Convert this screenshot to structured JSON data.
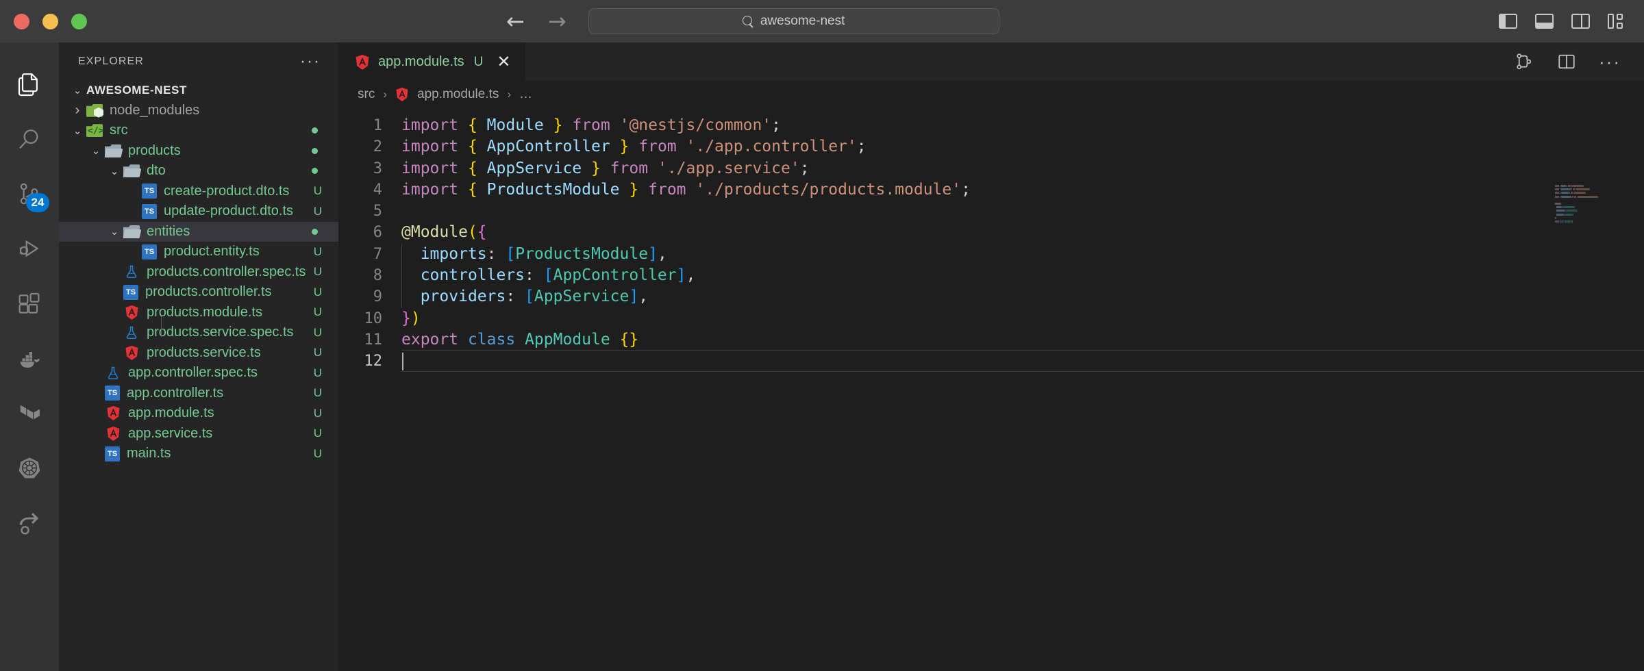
{
  "titlebar": {
    "traffic_lights": [
      "close",
      "minimize",
      "maximize"
    ],
    "back_arrow": "←",
    "forward_arrow": "→",
    "command_center_text": "awesome-nest",
    "command_center_icon": "search-icon",
    "layout_actions": [
      {
        "name": "toggle-primary-sidebar",
        "label": "Toggle Primary Side Bar"
      },
      {
        "name": "toggle-panel",
        "label": "Toggle Panel"
      },
      {
        "name": "toggle-secondary-sidebar",
        "label": "Toggle Secondary Side Bar"
      },
      {
        "name": "customize-layout",
        "label": "Customize Layout"
      }
    ]
  },
  "activitybar": {
    "items": [
      {
        "name": "explorer",
        "icon": "files-icon",
        "active": true,
        "badge": ""
      },
      {
        "name": "search",
        "icon": "search-icon",
        "active": false,
        "badge": ""
      },
      {
        "name": "source-control",
        "icon": "source-control-icon",
        "active": false,
        "badge": "24"
      },
      {
        "name": "run-and-debug",
        "icon": "debug-icon",
        "active": false,
        "badge": ""
      },
      {
        "name": "extensions",
        "icon": "extensions-icon",
        "active": false,
        "badge": ""
      },
      {
        "name": "docker",
        "icon": "docker-icon",
        "active": false,
        "badge": ""
      },
      {
        "name": "terraform",
        "icon": "terraform-icon",
        "active": false,
        "badge": ""
      },
      {
        "name": "kubernetes",
        "icon": "kubernetes-icon",
        "active": false,
        "badge": ""
      },
      {
        "name": "chameleon",
        "icon": "chameleon-icon",
        "active": false,
        "badge": ""
      }
    ]
  },
  "sidebar": {
    "title": "EXPLORER",
    "more_actions": "···",
    "root": {
      "label": "AWESOME-NEST",
      "expanded": true
    },
    "tree": [
      {
        "label": "node_modules",
        "indent": 1,
        "type": "folder",
        "icon": "folder-node-icon",
        "twisty": "collapsed",
        "color": "dim",
        "status": ""
      },
      {
        "label": "src",
        "indent": 1,
        "type": "folder",
        "icon": "folder-src-icon",
        "twisty": "expanded",
        "color": "green",
        "status": "dot"
      },
      {
        "label": "products",
        "indent": 2,
        "type": "folder",
        "icon": "folder-icon",
        "twisty": "expanded",
        "color": "green",
        "status": "dot"
      },
      {
        "label": "dto",
        "indent": 3,
        "type": "folder",
        "icon": "folder-icon",
        "twisty": "expanded",
        "color": "green",
        "status": "dot"
      },
      {
        "label": "create-product.dto.ts",
        "indent": 4,
        "type": "file",
        "icon": "typescript-icon",
        "twisty": "none",
        "color": "green",
        "status": "U"
      },
      {
        "label": "update-product.dto.ts",
        "indent": 4,
        "type": "file",
        "icon": "typescript-icon",
        "twisty": "none",
        "color": "green",
        "status": "U"
      },
      {
        "label": "entities",
        "indent": 3,
        "type": "folder",
        "icon": "folder-icon",
        "twisty": "expanded",
        "color": "green",
        "status": "dot",
        "selected": true
      },
      {
        "label": "product.entity.ts",
        "indent": 4,
        "type": "file",
        "icon": "typescript-icon",
        "twisty": "none",
        "color": "green",
        "status": "U"
      },
      {
        "label": "products.controller.spec.ts",
        "indent": 3,
        "type": "file",
        "icon": "test-flask-icon",
        "twisty": "none",
        "color": "green",
        "status": "U"
      },
      {
        "label": "products.controller.ts",
        "indent": 3,
        "type": "file",
        "icon": "typescript-icon",
        "twisty": "none",
        "color": "green",
        "status": "U"
      },
      {
        "label": "products.module.ts",
        "indent": 3,
        "type": "file",
        "icon": "nest-shield-icon",
        "twisty": "none",
        "color": "green",
        "status": "U"
      },
      {
        "label": "products.service.spec.ts",
        "indent": 3,
        "type": "file",
        "icon": "test-flask-icon",
        "twisty": "none",
        "color": "green",
        "status": "U"
      },
      {
        "label": "products.service.ts",
        "indent": 3,
        "type": "file",
        "icon": "nest-shield-icon",
        "twisty": "none",
        "color": "green",
        "status": "U"
      },
      {
        "label": "app.controller.spec.ts",
        "indent": 2,
        "type": "file",
        "icon": "test-flask-icon",
        "twisty": "none",
        "color": "green",
        "status": "U"
      },
      {
        "label": "app.controller.ts",
        "indent": 2,
        "type": "file",
        "icon": "typescript-icon",
        "twisty": "none",
        "color": "green",
        "status": "U"
      },
      {
        "label": "app.module.ts",
        "indent": 2,
        "type": "file",
        "icon": "nest-shield-icon",
        "twisty": "none",
        "color": "green",
        "status": "U"
      },
      {
        "label": "app.service.ts",
        "indent": 2,
        "type": "file",
        "icon": "nest-shield-icon",
        "twisty": "none",
        "color": "green",
        "status": "U"
      },
      {
        "label": "main.ts",
        "indent": 2,
        "type": "file",
        "icon": "typescript-icon",
        "twisty": "none",
        "color": "green",
        "status": "U"
      }
    ]
  },
  "editor": {
    "tab": {
      "filename": "app.module.ts",
      "icon": "nest-shield-icon",
      "dirty_badge": "U",
      "close": "✕"
    },
    "tab_actions": [
      {
        "name": "source-control-graph",
        "label": "Open Changes"
      },
      {
        "name": "split-editor",
        "label": "Split Editor Right"
      },
      {
        "name": "more-actions",
        "label": "More Actions..."
      }
    ],
    "breadcrumb": [
      "src",
      "app.module.ts",
      "…"
    ],
    "breadcrumb_file_icon": "nest-shield-icon",
    "line_numbers": [
      "1",
      "2",
      "3",
      "4",
      "5",
      "6",
      "7",
      "8",
      "9",
      "10",
      "11",
      "12"
    ],
    "current_line": 12,
    "code_lines": [
      [
        {
          "t": "import",
          "c": "kw"
        },
        {
          "t": " ",
          "c": "pl"
        },
        {
          "t": "{",
          "c": "br"
        },
        {
          "t": " ",
          "c": "pl"
        },
        {
          "t": "Module",
          "c": "id"
        },
        {
          "t": " ",
          "c": "pl"
        },
        {
          "t": "}",
          "c": "br"
        },
        {
          "t": " ",
          "c": "pl"
        },
        {
          "t": "from",
          "c": "kw"
        },
        {
          "t": " ",
          "c": "pl"
        },
        {
          "t": "'@nestjs/common'",
          "c": "str"
        },
        {
          "t": ";",
          "c": "pl"
        }
      ],
      [
        {
          "t": "import",
          "c": "kw"
        },
        {
          "t": " ",
          "c": "pl"
        },
        {
          "t": "{",
          "c": "br"
        },
        {
          "t": " ",
          "c": "pl"
        },
        {
          "t": "AppController",
          "c": "id"
        },
        {
          "t": " ",
          "c": "pl"
        },
        {
          "t": "}",
          "c": "br"
        },
        {
          "t": " ",
          "c": "pl"
        },
        {
          "t": "from",
          "c": "kw"
        },
        {
          "t": " ",
          "c": "pl"
        },
        {
          "t": "'./app.controller'",
          "c": "str"
        },
        {
          "t": ";",
          "c": "pl"
        }
      ],
      [
        {
          "t": "import",
          "c": "kw"
        },
        {
          "t": " ",
          "c": "pl"
        },
        {
          "t": "{",
          "c": "br"
        },
        {
          "t": " ",
          "c": "pl"
        },
        {
          "t": "AppService",
          "c": "id"
        },
        {
          "t": " ",
          "c": "pl"
        },
        {
          "t": "}",
          "c": "br"
        },
        {
          "t": " ",
          "c": "pl"
        },
        {
          "t": "from",
          "c": "kw"
        },
        {
          "t": " ",
          "c": "pl"
        },
        {
          "t": "'./app.service'",
          "c": "str"
        },
        {
          "t": ";",
          "c": "pl"
        }
      ],
      [
        {
          "t": "import",
          "c": "kw"
        },
        {
          "t": " ",
          "c": "pl"
        },
        {
          "t": "{",
          "c": "br"
        },
        {
          "t": " ",
          "c": "pl"
        },
        {
          "t": "ProductsModule",
          "c": "id"
        },
        {
          "t": " ",
          "c": "pl"
        },
        {
          "t": "}",
          "c": "br"
        },
        {
          "t": " ",
          "c": "pl"
        },
        {
          "t": "from",
          "c": "kw"
        },
        {
          "t": " ",
          "c": "pl"
        },
        {
          "t": "'./products/products.module'",
          "c": "str"
        },
        {
          "t": ";",
          "c": "pl"
        }
      ],
      [],
      [
        {
          "t": "@Module",
          "c": "dec"
        },
        {
          "t": "(",
          "c": "br"
        },
        {
          "t": "{",
          "c": "br2"
        }
      ],
      [
        {
          "t": "  ",
          "c": "pl"
        },
        {
          "t": "imports",
          "c": "id"
        },
        {
          "t": ": ",
          "c": "pl"
        },
        {
          "t": "[",
          "c": "br3"
        },
        {
          "t": "ProductsModule",
          "c": "cls"
        },
        {
          "t": "]",
          "c": "br3"
        },
        {
          "t": ",",
          "c": "pl"
        }
      ],
      [
        {
          "t": "  ",
          "c": "pl"
        },
        {
          "t": "controllers",
          "c": "id"
        },
        {
          "t": ": ",
          "c": "pl"
        },
        {
          "t": "[",
          "c": "br3"
        },
        {
          "t": "AppController",
          "c": "cls"
        },
        {
          "t": "]",
          "c": "br3"
        },
        {
          "t": ",",
          "c": "pl"
        }
      ],
      [
        {
          "t": "  ",
          "c": "pl"
        },
        {
          "t": "providers",
          "c": "id"
        },
        {
          "t": ": ",
          "c": "pl"
        },
        {
          "t": "[",
          "c": "br3"
        },
        {
          "t": "AppService",
          "c": "cls"
        },
        {
          "t": "]",
          "c": "br3"
        },
        {
          "t": ",",
          "c": "pl"
        }
      ],
      [
        {
          "t": "}",
          "c": "br2"
        },
        {
          "t": ")",
          "c": "br"
        }
      ],
      [
        {
          "t": "export",
          "c": "kw"
        },
        {
          "t": " ",
          "c": "pl"
        },
        {
          "t": "class",
          "c": "ctl"
        },
        {
          "t": " ",
          "c": "pl"
        },
        {
          "t": "AppModule",
          "c": "cls"
        },
        {
          "t": " ",
          "c": "pl"
        },
        {
          "t": "{}",
          "c": "br"
        }
      ],
      []
    ]
  },
  "colors": {
    "titlebar_bg": "#3c3c3c",
    "activitybar_bg": "#333333",
    "sidebar_bg": "#252526",
    "editor_bg": "#1e1e1e",
    "accent_badge": "#0078d4",
    "git_untracked": "#73c991",
    "typescript_blue": "#2f74c0",
    "nest_red": "#e23237",
    "selection_bg": "#37373d"
  }
}
